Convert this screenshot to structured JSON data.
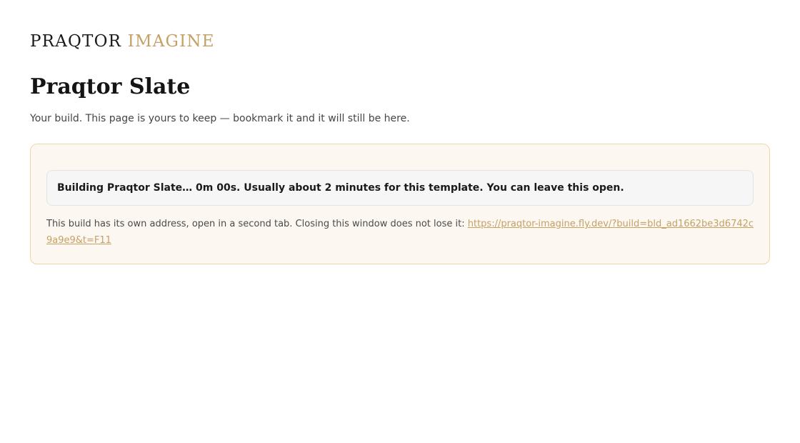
{
  "brand": {
    "part1": "PRAQTOR",
    "part2": "IMAGINE",
    "accent_color": "#c4a165"
  },
  "page": {
    "title": "Praqtor Slate",
    "subtitle": "Your build. This page is yours to keep — bookmark it and it will still be here."
  },
  "build_panel": {
    "status_text": "Building Praqtor Slate… 0m 00s. Usually about 2 minutes for this template. You can leave this open.",
    "note_text": "This build has its own address, open in a second tab. Closing this window does not lose it: ",
    "link_url": "https://praqtor-imagine.fly.dev/?build=bld_ad1662be3d6742c9a9e9&t=F11"
  }
}
